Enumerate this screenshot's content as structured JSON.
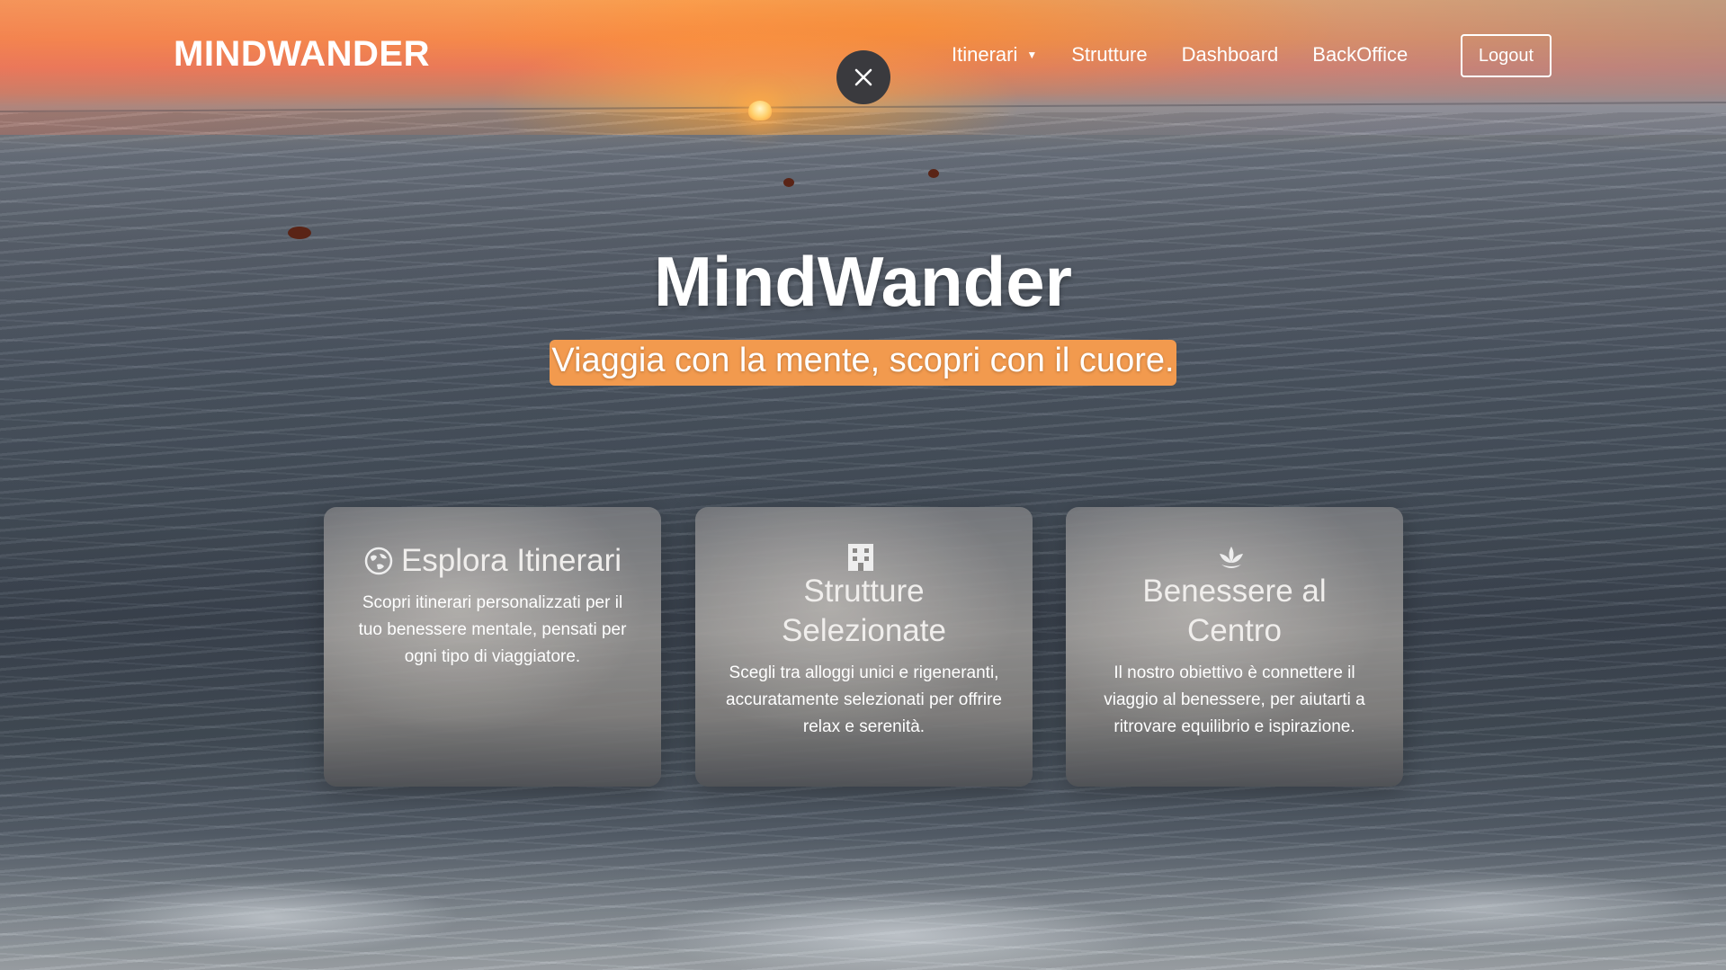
{
  "brand": "MINDWANDER",
  "nav": {
    "items": [
      {
        "label": "Itinerari",
        "has_dropdown": true
      },
      {
        "label": "Strutture"
      },
      {
        "label": "Dashboard"
      },
      {
        "label": "BackOffice"
      }
    ],
    "logout_label": "Logout"
  },
  "hero": {
    "title": "MindWander",
    "subtitle": "Viaggia con la mente, scopri con il cuore."
  },
  "cards": [
    {
      "icon": "globe-icon",
      "title": "Esplora Itinerari",
      "text": "Scopri itinerari personalizzati per il tuo benessere mentale, pensati per ogni tipo di viaggiatore."
    },
    {
      "icon": "hotel-icon",
      "title": "Strutture Selezionate",
      "text": "Scegli tra alloggi unici e rigeneranti, accuratamente selezionati per offrire relax e serenità."
    },
    {
      "icon": "lotus-icon",
      "title": "Benessere al Centro",
      "text": "Il nostro obiettivo è connettere il viaggio al benessere, per aiutarti a ritrovare equilibrio e ispirazione."
    }
  ],
  "colors": {
    "accent": "#f29a4e",
    "close_button_bg": "#3a3a3e"
  }
}
